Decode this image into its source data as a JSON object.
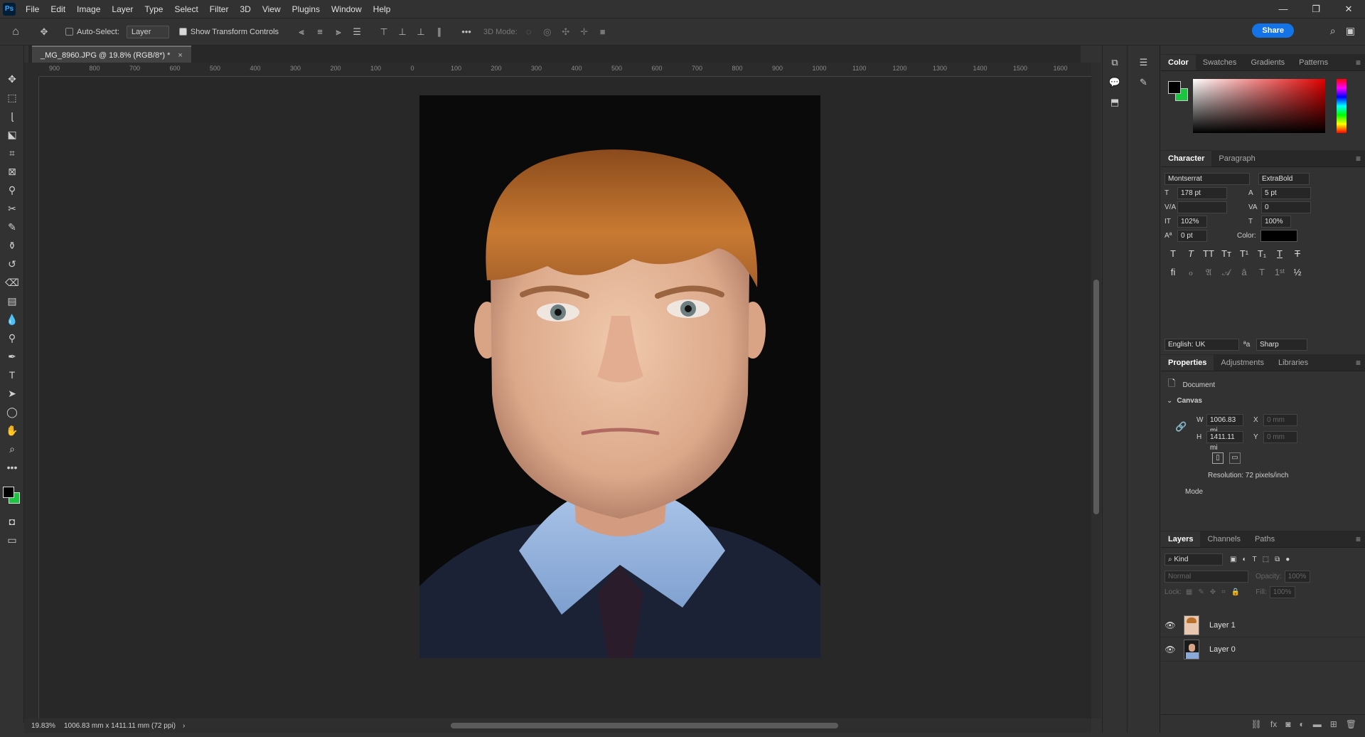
{
  "menu": [
    "File",
    "Edit",
    "Image",
    "Layer",
    "Type",
    "Select",
    "Filter",
    "3D",
    "View",
    "Plugins",
    "Window",
    "Help"
  ],
  "app_logo": "Ps",
  "options": {
    "auto_select_label": "Auto-Select:",
    "auto_select_target": "Layer",
    "show_transform_label": "Show Transform Controls",
    "three_d_mode_label": "3D Mode:",
    "share_label": "Share"
  },
  "document_tab": "_MG_8960.JPG @ 19.8% (RGB/8*) *",
  "ruler_labels": [
    "900",
    "800",
    "700",
    "600",
    "500",
    "400",
    "300",
    "200",
    "100",
    "0",
    "100",
    "200",
    "300",
    "400",
    "500",
    "600",
    "700",
    "800",
    "900",
    "1000",
    "1100",
    "1200",
    "1300",
    "1400",
    "1500",
    "1600"
  ],
  "status": {
    "zoom": "19.83%",
    "dims": "1006.83 mm x 1411.11 mm (72 ppi)"
  },
  "color_panel": {
    "tabs": [
      "Color",
      "Swatches",
      "Gradients",
      "Patterns"
    ],
    "fg": "#000000",
    "bg": "#1bc53f"
  },
  "character": {
    "tabs": [
      "Character",
      "Paragraph"
    ],
    "font_family": "Montserrat",
    "font_style": "ExtraBold",
    "size": "178 pt",
    "leading": "5 pt",
    "tracking": "0",
    "vscale": "102%",
    "hscale": "100%",
    "baseline": "0 pt",
    "color_label": "Color:",
    "language": "English: UK",
    "antialias": "Sharp"
  },
  "properties": {
    "tabs": [
      "Properties",
      "Adjustments",
      "Libraries"
    ],
    "doc_label": "Document",
    "canvas_label": "Canvas",
    "w_label": "W",
    "w_value": "1006.83 mi",
    "h_label": "H",
    "h_value": "1411.11 mi",
    "x_label": "X",
    "x_placeholder": "0 mm",
    "y_label": "Y",
    "y_placeholder": "0 mm",
    "resolution": "Resolution: 72 pixels/inch",
    "mode_label": "Mode"
  },
  "layers": {
    "tabs": [
      "Layers",
      "Channels",
      "Paths"
    ],
    "filter": "Kind",
    "blend": "Normal",
    "opacity_label": "Opacity:",
    "opacity": "100%",
    "lock_label": "Lock:",
    "fill_label": "Fill:",
    "fill": "100%",
    "items": [
      {
        "name": "Layer 1"
      },
      {
        "name": "Layer 0"
      }
    ]
  }
}
